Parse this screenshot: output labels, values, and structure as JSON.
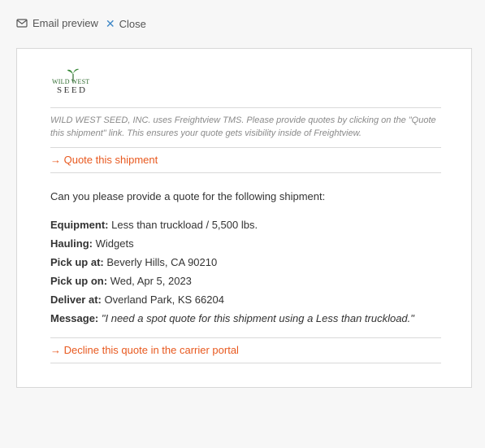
{
  "header": {
    "title": "Email preview",
    "close_label": "Close"
  },
  "logo": {
    "top_text": "WILD WEST",
    "bottom_text": "SEED"
  },
  "email": {
    "notice": "WILD WEST SEED, INC. uses Freightview TMS. Please provide quotes by clicking on the \"Quote this shipment\" link. This ensures your quote gets visibility inside of Freightview.",
    "quote_link": "→ Quote this shipment",
    "intro": "Can you please provide a quote for the following shipment:",
    "details": [
      {
        "label": "Equipment:",
        "value": "Less than truckload / 5,500 lbs."
      },
      {
        "label": "Hauling:",
        "value": "Widgets"
      },
      {
        "label": "Pick up at:",
        "value": "Beverly Hills, CA 90210"
      },
      {
        "label": "Pick up on:",
        "value": "Wed, Apr 5, 2023"
      },
      {
        "label": "Deliver at:",
        "value": "Overland Park, KS 66204"
      },
      {
        "label": "Message:",
        "value": "\"I need a spot quote for this shipment using a Less than truckload.\""
      }
    ],
    "decline_link": "→ Decline this quote in the carrier portal"
  },
  "colors": {
    "link": "#e8591f",
    "close_icon": "#3d86c6",
    "logo_green": "#2f6b2f"
  },
  "icons": {
    "header_icon": "envelope-icon",
    "close_icon": "close-icon"
  }
}
